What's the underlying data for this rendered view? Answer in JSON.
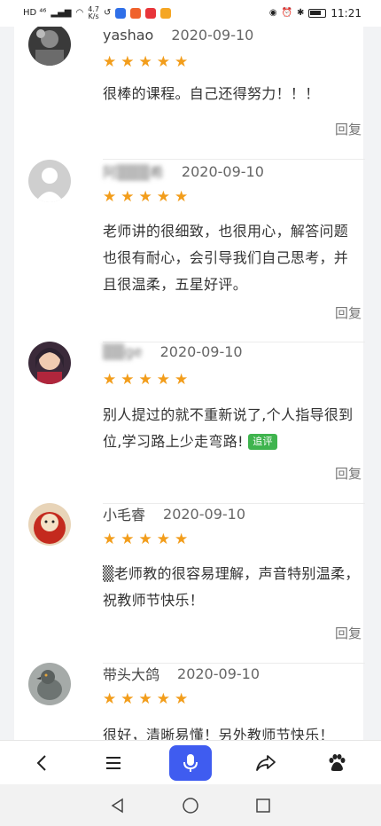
{
  "status_bar": {
    "left_text": "HD ⁴⁶",
    "net_speed_value": "4.7",
    "net_speed_unit": "K/s",
    "time": "11:21"
  },
  "reviews": [
    {
      "name": "yashao",
      "name_blurred": false,
      "date": "2020-09-10",
      "rating": 5,
      "stars": "★★★★★",
      "text": "很棒的课程。自己还得努力！！！",
      "follow_up": "",
      "reply": "回复"
    },
    {
      "name": "阿▒▒▒希",
      "name_blurred": true,
      "date": "2020-09-10",
      "rating": 5,
      "stars": "★★★★★",
      "text": "老师讲的很细致，也很用心，解答问题也很有耐心，会引导我们自己思考，并且很温柔，五星好评。",
      "follow_up": "",
      "reply": "回复"
    },
    {
      "name": "▒▒ge",
      "name_blurred": true,
      "date": "2020-09-10",
      "rating": 5,
      "stars": "★★★★★",
      "text": "别人提过的就不重新说了,个人指导很到位,学习路上少走弯路!",
      "follow_up": "追评",
      "reply": "回复"
    },
    {
      "name": "小毛睿",
      "name_blurred": false,
      "date": "2020-09-10",
      "rating": 5,
      "stars": "★★★★★",
      "text": "▒老师教的很容易理解，声音特别温柔，祝教师节快乐！",
      "follow_up": "",
      "reply": "回复"
    },
    {
      "name": "带头大鸽",
      "name_blurred": false,
      "date": "2020-09-10",
      "rating": 5,
      "stars": "★★★★★",
      "text": "很好，清晰易懂！另外教师节快乐！",
      "follow_up": "",
      "reply": ""
    }
  ],
  "toolbar": {
    "icons": [
      "back-icon",
      "menu-icon",
      "microphone-icon",
      "share-icon",
      "baidu-paw-icon"
    ]
  },
  "colors": {
    "star": "#f29d1b",
    "accent": "#3f5cf0",
    "tag": "#3fb44e"
  }
}
